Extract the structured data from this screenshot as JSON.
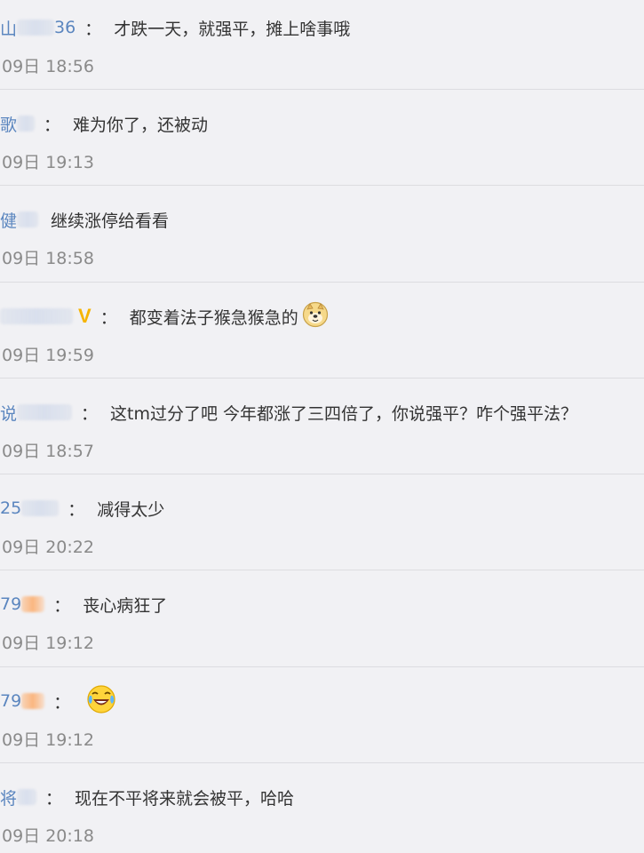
{
  "comments": [
    {
      "user_visible": "山",
      "user_tail": "36",
      "text": "才跌一天，就强平，摊上啥事哦",
      "time": "09日 18:56"
    },
    {
      "user_visible": "歌",
      "user_tail": "",
      "text": "难为你了，还被动",
      "time": "09日 19:13"
    },
    {
      "user_visible": "健",
      "user_tail": "",
      "text": "继续涨停给看看",
      "time": "09日 18:58"
    },
    {
      "user_visible": "",
      "user_tail": "",
      "text": "都变着法子猴急猴急的",
      "time": "09日 19:59",
      "verified": "V",
      "emoji": "doge-emoji"
    },
    {
      "user_visible": "说",
      "user_tail": "",
      "text": "这tm过分了吧 今年都涨了三四倍了，你说强平？咋个强平法？",
      "time": "09日 18:57"
    },
    {
      "user_visible": "25",
      "user_tail": "",
      "text": "减得太少",
      "time": "09日 20:22"
    },
    {
      "user_visible": "79",
      "user_tail": "",
      "text": "丧心病狂了",
      "time": "09日 19:12"
    },
    {
      "user_visible": "79",
      "user_tail": "",
      "text": "",
      "time": "09日 19:12",
      "emoji": "laugh-cry-emoji"
    },
    {
      "user_visible": "将",
      "user_tail": "",
      "text": "现在不平将来就会被平，哈哈",
      "time": "09日 20:18"
    }
  ],
  "colon": "：",
  "colors": {
    "username": "#5b86bf",
    "text": "#333333",
    "time": "#8a8a8a",
    "background": "#f1f1f4",
    "verified": "#f6b400"
  }
}
